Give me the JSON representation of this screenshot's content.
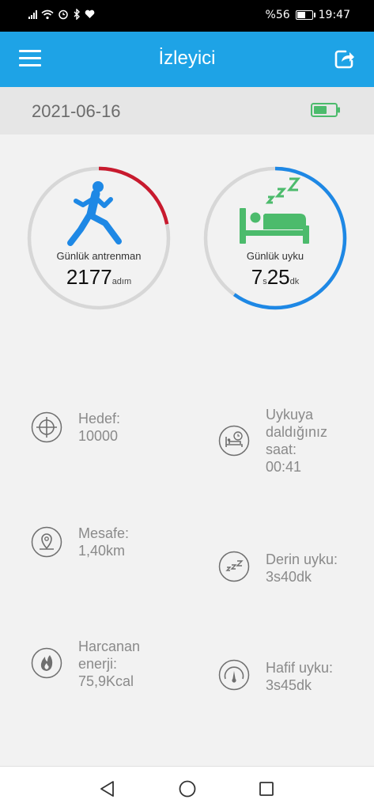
{
  "status_bar": {
    "battery_percent": "%56",
    "time": "19:47",
    "battery_level": 0.56
  },
  "app_bar": {
    "title": "İzleyici"
  },
  "date_bar": {
    "date": "2021-06-16",
    "device_battery_level": 0.6
  },
  "rings": {
    "training": {
      "label": "Günlük antrenman",
      "value": "2177",
      "unit": "adım",
      "progress": 0.2177,
      "color": "#c81a2e",
      "track": "#d7d7d7"
    },
    "sleep": {
      "label": "Günlük uyku",
      "hours": "7",
      "hours_unit": "s",
      "minutes": "25",
      "minutes_unit": "dk",
      "progress": 0.6,
      "color": "#1e88e5",
      "track": "#d7d7d7"
    }
  },
  "stats": {
    "goal": {
      "lines": [
        "Hedef:",
        "10000"
      ],
      "icon": "target-icon"
    },
    "distance": {
      "lines": [
        "Mesafe:",
        "1,40km"
      ],
      "icon": "location-pin-icon"
    },
    "energy": {
      "lines": [
        "Harcanan",
        "enerji:",
        "75,9Kcal"
      ],
      "icon": "flame-icon"
    },
    "sleep_time": {
      "lines": [
        "Uykuya",
        "daldığınız",
        "saat:",
        "00:41"
      ],
      "icon": "sleep-clock-icon"
    },
    "deep_sleep": {
      "lines": [
        "Derin uyku:",
        "3s40dk"
      ],
      "icon": "zzz-icon"
    },
    "light_sleep": {
      "lines": [
        "Hafif uyku:",
        "3s45dk"
      ],
      "icon": "gauge-icon"
    }
  },
  "colors": {
    "app_bar": "#1ea3e6",
    "background": "#f2f2f2",
    "green": "#4cbb6c"
  }
}
